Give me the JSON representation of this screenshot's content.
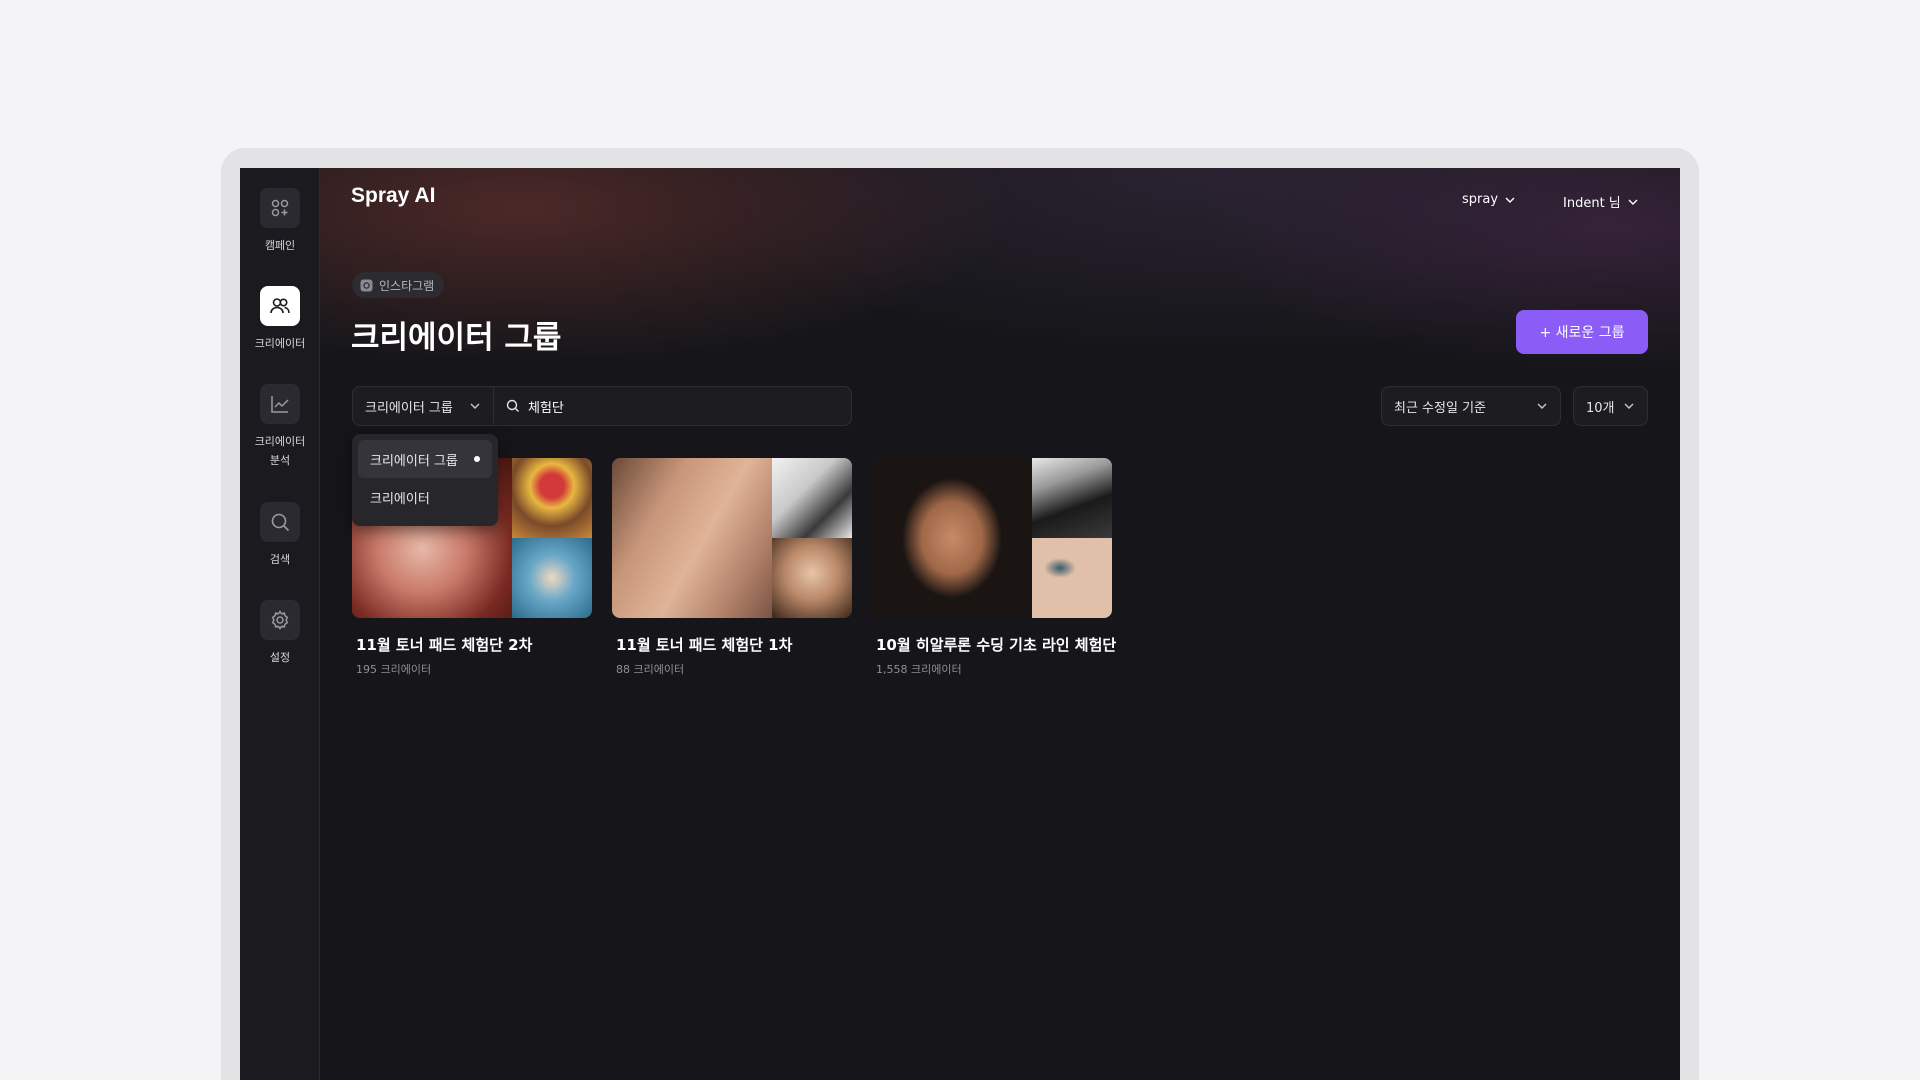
{
  "app": {
    "title": "Spray AI"
  },
  "sidebar": {
    "items": [
      {
        "label": "캠페인",
        "icon": "campaign-icon",
        "active": false
      },
      {
        "label": "크리에이터",
        "icon": "users-icon",
        "active": true
      },
      {
        "label": "크리에이터\n분석",
        "icon": "chart-line-icon",
        "active": false
      },
      {
        "label": "검색",
        "icon": "search-icon",
        "active": false
      },
      {
        "label": "설정",
        "icon": "gear-icon",
        "active": false
      }
    ]
  },
  "header": {
    "workspace_label": "spray",
    "user_label": "Indent 님"
  },
  "page": {
    "platform_chip": "인스타그램",
    "title": "크리에이터 그룹",
    "new_button_label": "+ 새로운 그룹"
  },
  "filters": {
    "scope_selected": "크리에이터 그룹",
    "search_value": "체험단",
    "sort_selected": "최근 수정일 기준",
    "page_size_selected": "10개"
  },
  "scope_dropdown": {
    "options": [
      {
        "label": "크리에이터 그룹",
        "selected": true
      },
      {
        "label": "크리에이터",
        "selected": false
      }
    ]
  },
  "groups": [
    {
      "title": "11월 토너 패드 체험단 2차",
      "count": "195 크리에이터"
    },
    {
      "title": "11월 토너 패드 체험단 1차",
      "count": "88 크리에이터"
    },
    {
      "title": "10월 히알루론 수딩 기초 라인 체험단",
      "count": "1,558 크리에이터"
    }
  ],
  "colors": {
    "accent": "#8b5cf6",
    "background": "#16161a",
    "sidebar": "#1b1b1f"
  }
}
